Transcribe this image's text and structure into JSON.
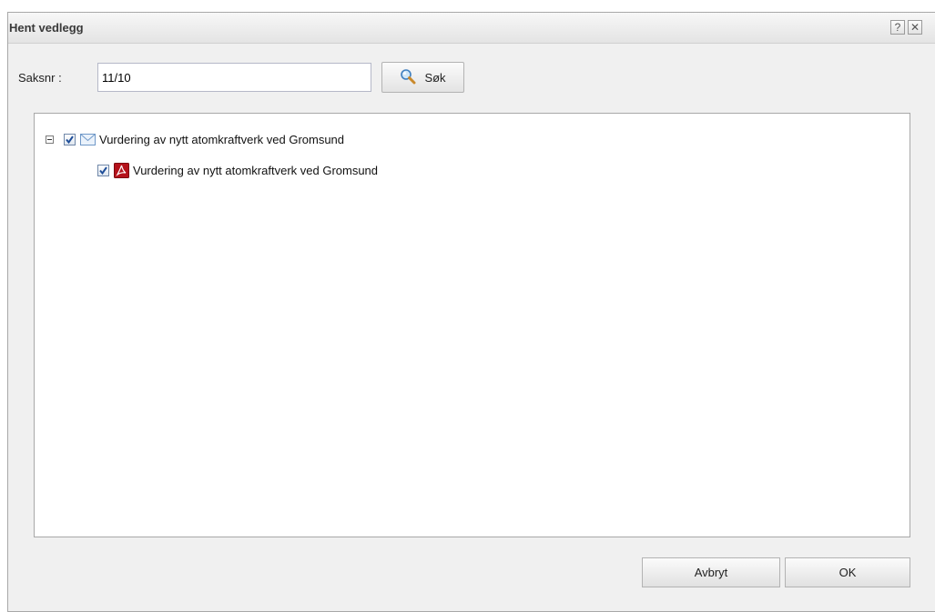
{
  "dialog": {
    "title": "Hent vedlegg",
    "help_icon": "?",
    "close_icon": "✕"
  },
  "search": {
    "label": "Saksnr :",
    "value": "11/10",
    "button_label": "Søk",
    "button_icon": "magnifier-icon"
  },
  "tree": {
    "parent": {
      "label": "Vurdering av nytt atomkraftverk ved Gromsund",
      "checked": true,
      "expanded": true,
      "icon": "envelope-icon"
    },
    "child": {
      "label": "Vurdering av nytt atomkraftverk ved Gromsund",
      "checked": true,
      "icon": "pdf-icon"
    }
  },
  "footer": {
    "cancel_label": "Avbryt",
    "ok_label": "OK"
  },
  "colors": {
    "dialog_bg": "#f0f0f0",
    "pdf_red": "#b5121b",
    "checkmark_blue": "#1f4e99"
  }
}
